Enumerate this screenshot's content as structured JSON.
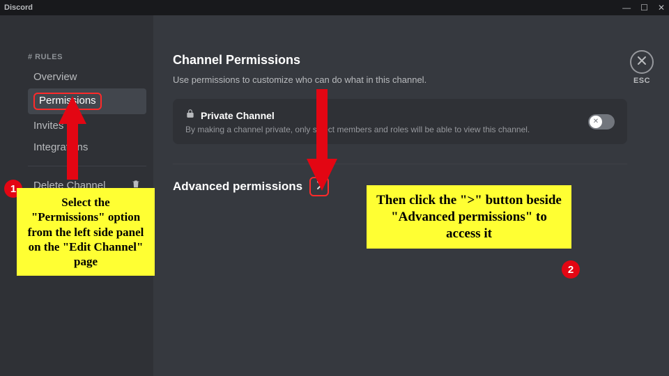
{
  "titlebar": {
    "app_name": "Discord"
  },
  "sidebar": {
    "header": "# RULES",
    "items": [
      {
        "label": "Overview"
      },
      {
        "label": "Permissions"
      },
      {
        "label": "Invites"
      },
      {
        "label": "Integrations"
      }
    ],
    "delete_label": "Delete Channel"
  },
  "content": {
    "heading": "Channel Permissions",
    "subtext": "Use permissions to customize who can do what in this channel.",
    "private_card": {
      "title": "Private Channel",
      "desc": "By making a channel private, only select members and roles will be able to view this channel."
    },
    "advanced_label": "Advanced permissions"
  },
  "esc": {
    "label": "ESC"
  },
  "annotations": {
    "badge1": "1",
    "badge2": "2",
    "callout1": "Select the \"Permissions\" option from the left side panel on the \"Edit Channel\" page",
    "callout2": "Then click the \">\" button beside \"Advanced permissions\" to access it"
  }
}
